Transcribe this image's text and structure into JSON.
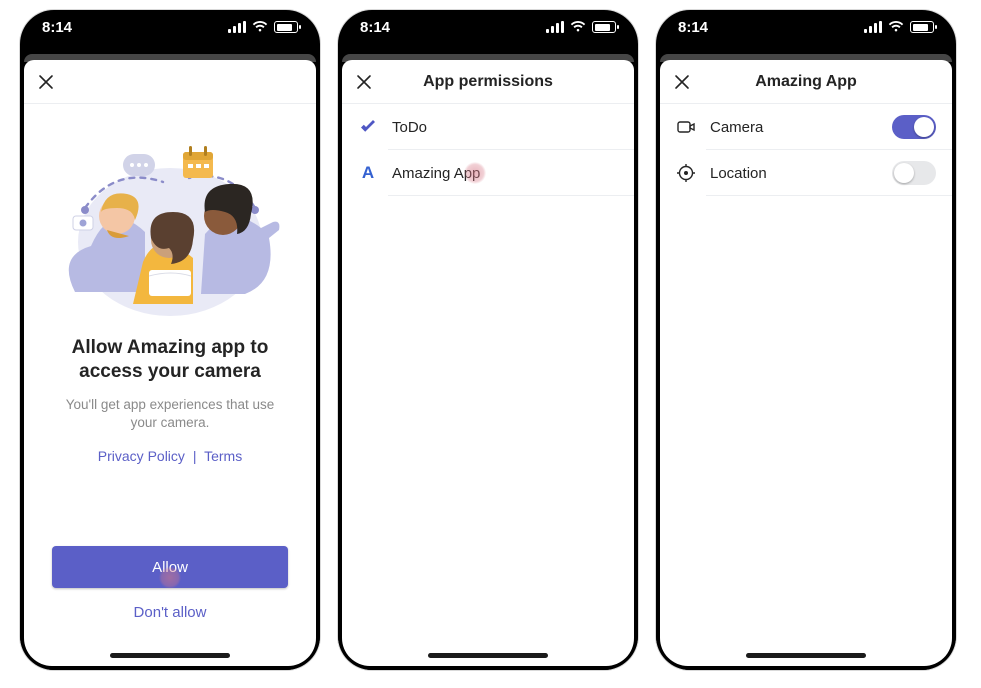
{
  "status": {
    "time": "8:14"
  },
  "colors": {
    "accent": "#5b5fc7",
    "link": "#5b5fc7"
  },
  "screen1": {
    "title": "Allow Amazing app to access your camera",
    "subtitle": "You'll get app experiences that use your camera.",
    "privacy_label": "Privacy Policy",
    "terms_label": "Terms",
    "separator": "|",
    "allow_label": "Allow",
    "deny_label": "Don't allow"
  },
  "screen2": {
    "title": "App permissions",
    "items": [
      {
        "icon": "check",
        "label": "ToDo"
      },
      {
        "icon": "letter-A",
        "label": "Amazing App"
      }
    ]
  },
  "screen3": {
    "title": "Amazing App",
    "permissions": [
      {
        "icon": "camera",
        "label": "Camera",
        "enabled": true
      },
      {
        "icon": "location",
        "label": "Location",
        "enabled": false
      }
    ]
  }
}
